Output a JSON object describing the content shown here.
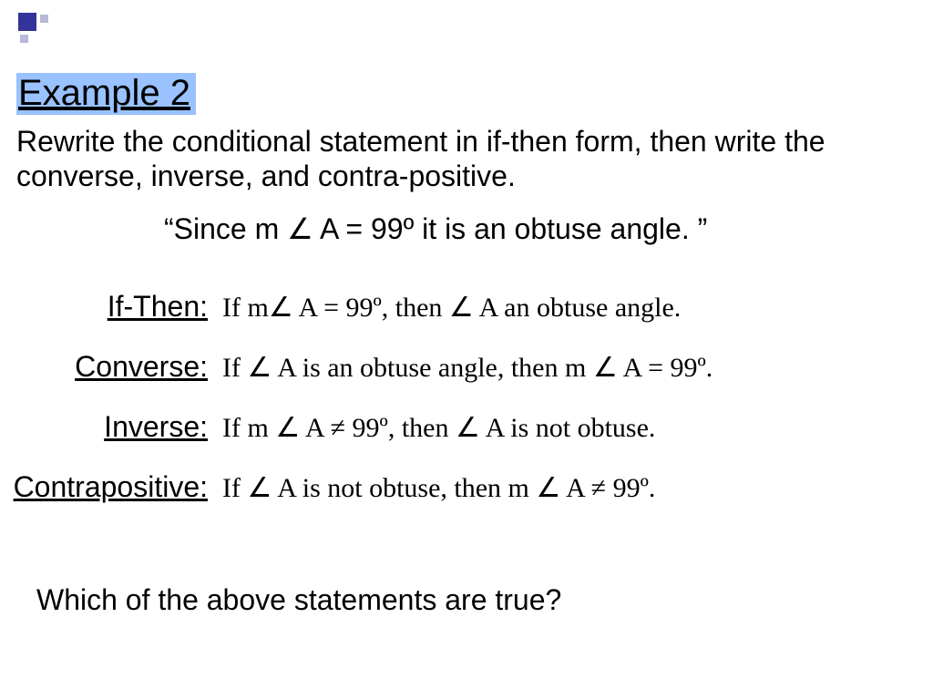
{
  "title": "Example 2",
  "instruction": "Rewrite the conditional statement in if-then form, then write the converse, inverse, and contra-positive.",
  "quoted_statement": "“Since m ∠ A = 99º it is an obtuse angle. ”",
  "rows": [
    {
      "label": "If-Then:",
      "answer": "If m∠ A = 99º, then ∠ A an obtuse angle."
    },
    {
      "label": "Converse:",
      "answer": "If ∠ A is an obtuse angle, then m ∠ A = 99º."
    },
    {
      "label": "Inverse:",
      "answer": "If m ∠ A ≠ 99º, then ∠ A is not obtuse."
    },
    {
      "label": "Contrapositive:",
      "answer": "If ∠ A is not obtuse, then m ∠ A ≠ 99º."
    }
  ],
  "closing_question": "Which of the above statements are true?"
}
